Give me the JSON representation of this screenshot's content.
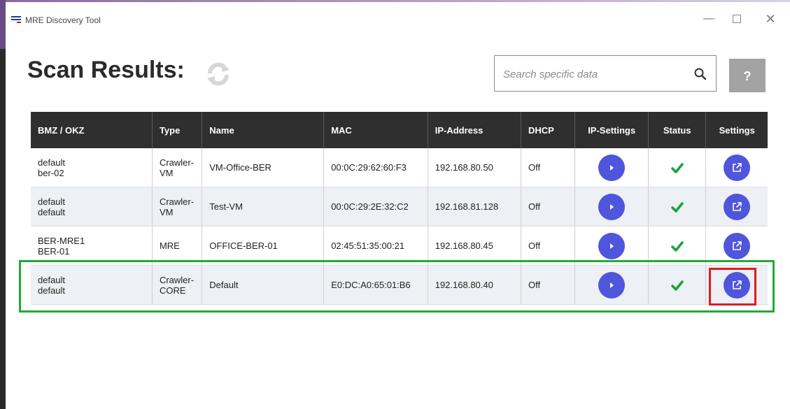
{
  "window": {
    "title": "MRE Discovery Tool",
    "minimize": "—",
    "close": "✕"
  },
  "heading": "Scan Results:",
  "search": {
    "placeholder": "Search specific data"
  },
  "help_label": "?",
  "columns": [
    "BMZ / OKZ",
    "Type",
    "Name",
    "MAC",
    "IP-Address",
    "DHCP",
    "IP-Settings",
    "Status",
    "Settings"
  ],
  "rows": [
    {
      "bmz1": "default",
      "bmz2": "ber-02",
      "type1": "Crawler-",
      "type2": "VM",
      "name": "VM-Office-BER",
      "mac": "00:0C:29:62:60:F3",
      "ip": "192.168.80.50",
      "dhcp": "Off",
      "status": "ok"
    },
    {
      "bmz1": "default",
      "bmz2": "default",
      "type1": "Crawler-",
      "type2": "VM",
      "name": "Test-VM",
      "mac": "00:0C:29:2E:32:C2",
      "ip": "192.168.81.128",
      "dhcp": "Off",
      "status": "ok"
    },
    {
      "bmz1": "BER-MRE1",
      "bmz2": "BER-01",
      "type1": "MRE",
      "type2": "",
      "name": "OFFICE-BER-01",
      "mac": "02:45:51:35:00:21",
      "ip": "192.168.80.45",
      "dhcp": "Off",
      "status": "ok"
    },
    {
      "bmz1": "default",
      "bmz2": "default",
      "type1": "Crawler-",
      "type2": "CORE",
      "name": "Default",
      "mac": "E0:DC:A0:65:01:B6",
      "ip": "192.168.80.40",
      "dhcp": "Off",
      "status": "ok"
    }
  ],
  "colors": {
    "header_bg": "#2f2f2f",
    "button": "#4f56db",
    "status_ok": "#1aa33a",
    "help_bg": "#a3a3a3",
    "highlight_row": "#22aa3d",
    "highlight_button": "#e11b22"
  },
  "icons": {
    "app": "app-logo-icon",
    "refresh": "refresh-icon",
    "search": "search-icon",
    "ip_settings": "play-icon",
    "status": "check-icon",
    "settings": "external-link-icon"
  }
}
